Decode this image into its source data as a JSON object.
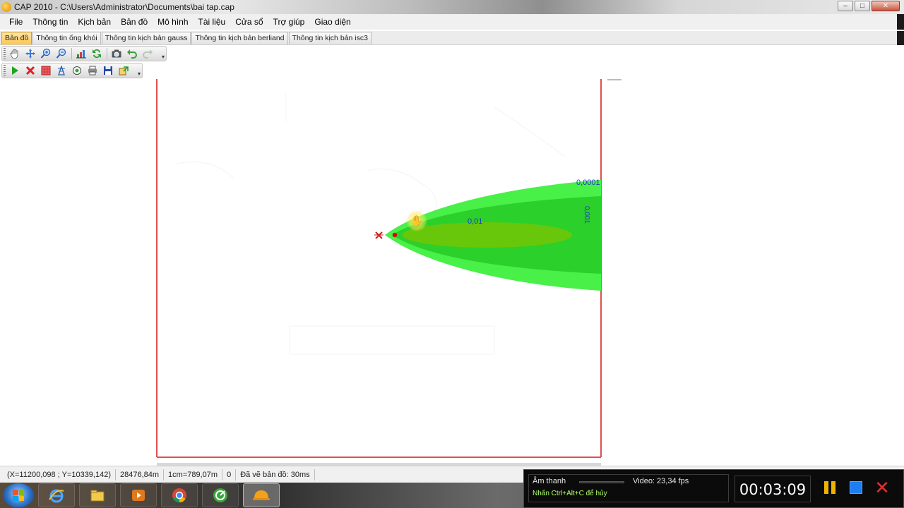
{
  "window": {
    "title": "CAP 2010 - C:\\Users\\Administrator\\Documents\\bai tap.cap",
    "controls": [
      "–",
      "□",
      "✕"
    ]
  },
  "menu": [
    "File",
    "Thông tin",
    "Kịch bản",
    "Bản đồ",
    "Mô hình",
    "Tài liệu",
    "Cửa sổ",
    "Trợ giúp",
    "Giao diện"
  ],
  "tabs": [
    {
      "label": "Bản đồ",
      "active": true
    },
    {
      "label": "Thông tin ống khói",
      "active": false
    },
    {
      "label": "Thông tin kịch bản gauss",
      "active": false
    },
    {
      "label": "Thông tin kịch bản berliand",
      "active": false
    },
    {
      "label": "Thông tin kịch bản isc3",
      "active": false
    }
  ],
  "toolbar1_icons": [
    "pan-hand-icon",
    "select-arrow-icon",
    "zoom-in-icon",
    "zoom-out-icon",
    "chart-icon",
    "refresh-icon",
    "camera-icon",
    "undo-icon",
    "redo-icon"
  ],
  "toolbar2_icons": [
    "run-icon",
    "delete-icon",
    "grid-icon",
    "tower-icon",
    "target-icon",
    "print-icon",
    "save-icon",
    "export-icon"
  ],
  "map": {
    "contour_labels": {
      "c1": "0,0001",
      "c2": "0,001",
      "c3": "0,01"
    },
    "colors": {
      "outer": "#48f048",
      "middle": "#2bd02b",
      "inner": "#7ec400",
      "frame": "#e05050",
      "source": "#e00000"
    }
  },
  "status": {
    "coords": "(X=11200,098 ; Y=10339,142)",
    "distance": "28476,84m",
    "scale": "1cm=789,07m",
    "count": "0",
    "render": "Đã vẽ bản đồ: 30ms"
  },
  "taskbar_apps": [
    "ie-icon",
    "explorer-icon",
    "media-player-icon",
    "chrome-icon",
    "app-green-icon",
    "cap-app-icon"
  ],
  "recorder": {
    "audio_label": "Âm thanh",
    "video_label": "Video: 23,34 fps",
    "hint": "Nhấn Ctrl+Alt+C để hủy",
    "time": "00:03:09"
  }
}
